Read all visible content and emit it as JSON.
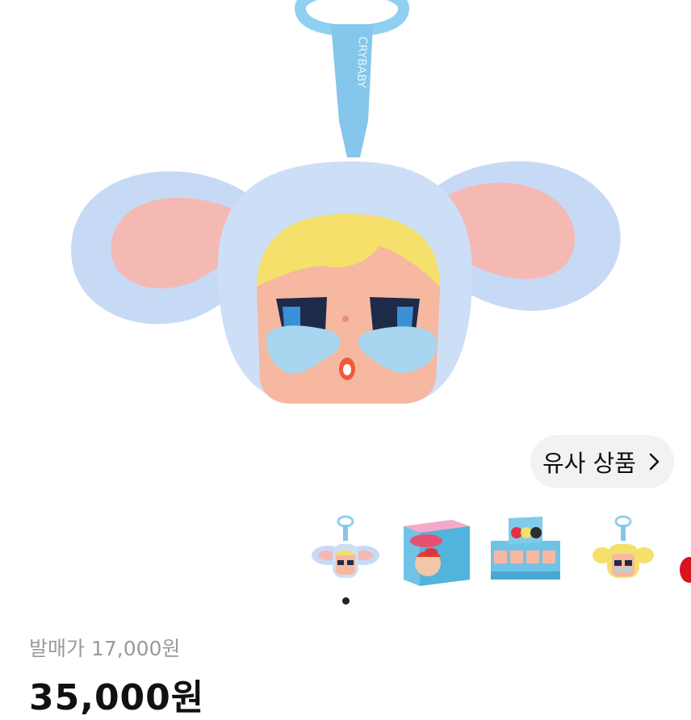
{
  "product": {
    "image_alt_icon": "keychain-plush-icon",
    "release_price_label": "발매가 17,000원",
    "price": "35,000원"
  },
  "similar_button": {
    "label": "유사 상품",
    "icon": "chevron-right-icon"
  },
  "thumbnails": [
    {
      "icon": "keychain-bunny-thumb"
    },
    {
      "icon": "blind-box-thumb"
    },
    {
      "icon": "display-box-thumb"
    },
    {
      "icon": "keychain-blonde-thumb"
    },
    {
      "icon": "red-item-thumb-partial"
    }
  ],
  "carousel": {
    "active_index": 1
  },
  "colors": {
    "fur_blue": "#c7daf5",
    "ear_pink": "#f5b9b4",
    "strap_blue": "#7fc3ea",
    "ring_blue": "#8fd0f2",
    "hair_yellow": "#f4e06a",
    "skin": "#f6b8a0",
    "tear_blue": "#a8d5ef"
  }
}
